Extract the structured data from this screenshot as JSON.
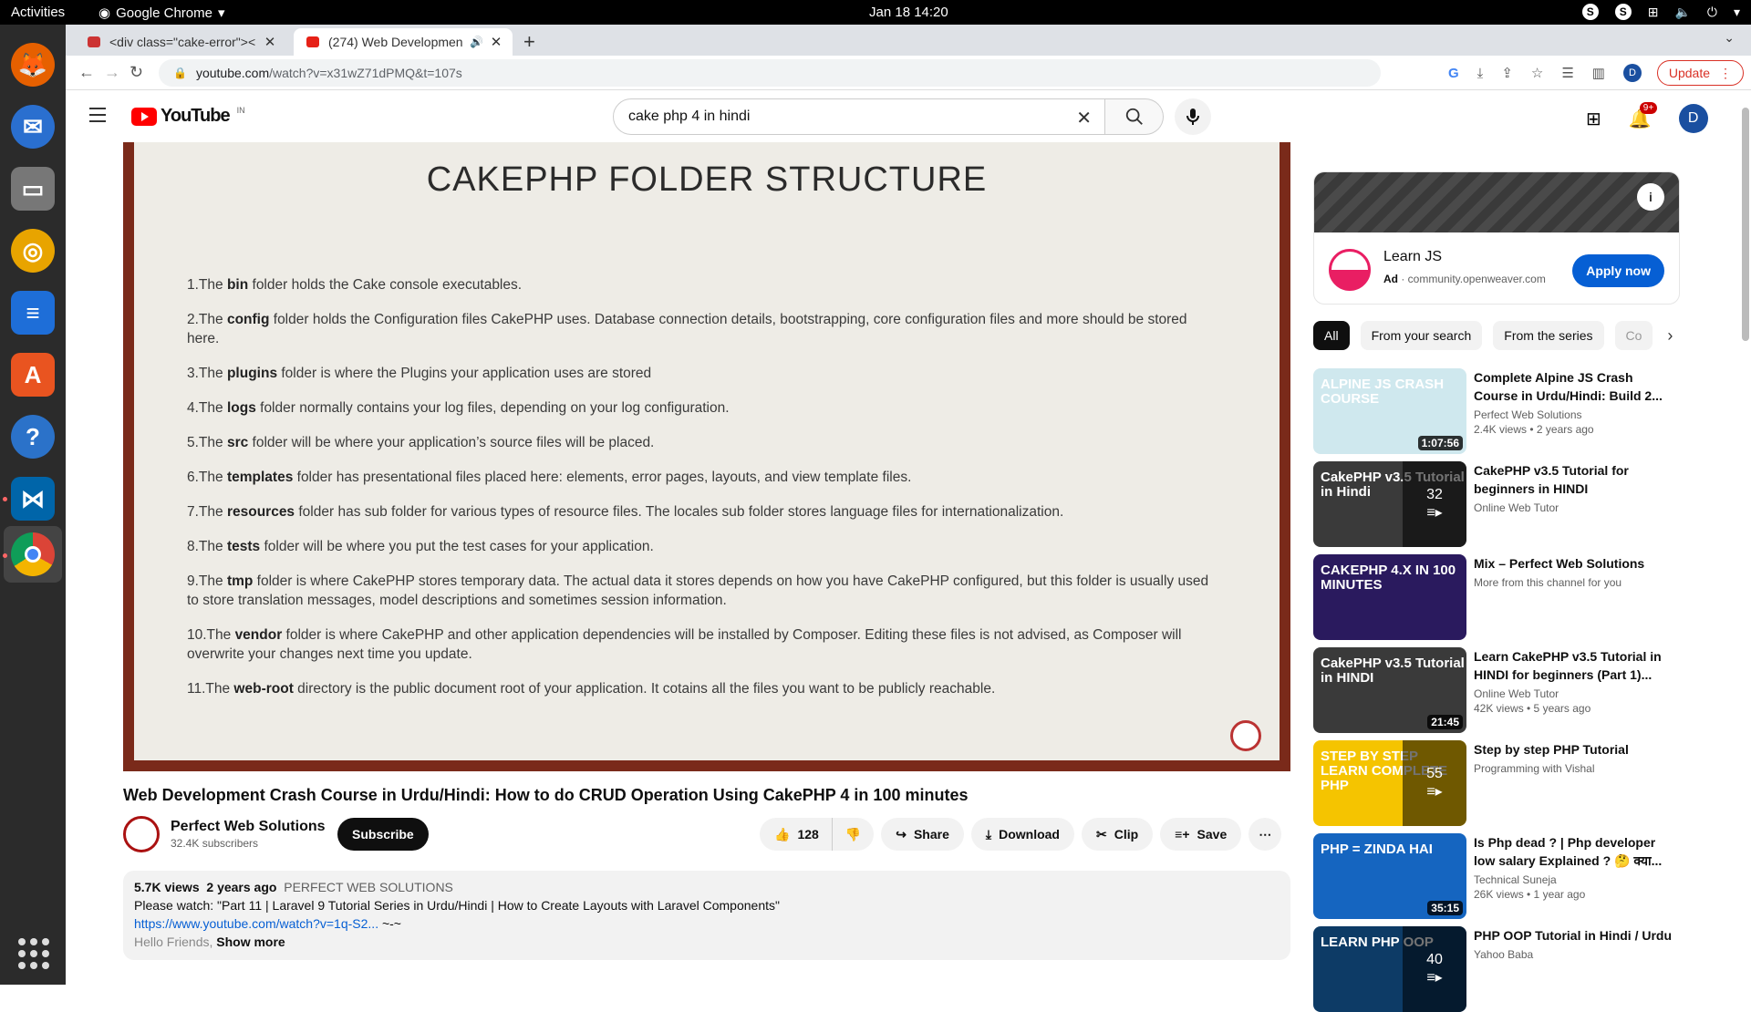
{
  "os": {
    "activities": "Activities",
    "app_name": "Google Chrome",
    "clock": "Jan 18  14:20"
  },
  "browser": {
    "tabs": [
      {
        "title": "<div class=\"cake-error\"><"
      },
      {
        "title": "(274) Web Developmen"
      }
    ],
    "url_host": "youtube.com",
    "url_path": "/watch?v=x31wZ71dPMQ&t=107s",
    "profile_letter": "D",
    "update_label": "Update"
  },
  "youtube": {
    "logo_text": "YouTube",
    "region": "IN",
    "search_query": "cake php 4 in hindi",
    "notif_count": "9+",
    "avatar_letter": "D"
  },
  "slide": {
    "heading": "CAKEPHP FOLDER STRUCTURE",
    "items": [
      {
        "n": "1.The ",
        "b": "bin",
        "t": " folder holds the Cake console executables."
      },
      {
        "n": "2.The ",
        "b": "config",
        "t": " folder holds the Configuration files CakePHP uses. Database connection details, bootstrapping, core configuration files and more should be stored here."
      },
      {
        "n": "3.The ",
        "b": "plugins",
        "t": " folder is where the Plugins your application uses are stored"
      },
      {
        "n": "4.The ",
        "b": "logs",
        "t": " folder normally contains your log files, depending on your log configuration."
      },
      {
        "n": "5.The ",
        "b": "src",
        "t": " folder will be where your application’s source files will be placed."
      },
      {
        "n": "6.The ",
        "b": "templates",
        "t": " folder has presentational files placed here: elements, error pages, layouts, and view template files."
      },
      {
        "n": "7.The ",
        "b": "resources",
        "t": " folder has sub folder for various types of resource files. The locales sub folder stores language files for internationalization."
      },
      {
        "n": "8.The ",
        "b": "tests",
        "t": " folder will be where you put the test cases for your application."
      },
      {
        "n": "9.The ",
        "b": "tmp",
        "t": " folder is where CakePHP stores temporary data. The actual data it stores depends on how you have CakePHP configured, but this folder is usually used to store translation messages, model descriptions and sometimes session information."
      },
      {
        "n": "10.The ",
        "b": "vendor",
        "t": " folder is where CakePHP and other application dependencies will be installed by Composer. Editing these files is not advised, as Composer will overwrite your changes next time you update."
      },
      {
        "n": "11.The ",
        "b": "web-root",
        "t": " directory is the public document root of your application. It cotains all the files you want to be publicly reachable."
      }
    ]
  },
  "video": {
    "title": "Web Development Crash Course in Urdu/Hindi: How to do CRUD Operation Using CakePHP 4 in 100 minutes",
    "channel": "Perfect Web Solutions",
    "subscribers": "32.4K subscribers",
    "subscribe_label": "Subscribe",
    "likes": "128",
    "share": "Share",
    "download": "Download",
    "clip": "Clip",
    "save": "Save",
    "views": "5.7K views",
    "age": "2 years ago",
    "tag": "PERFECT WEB SOLUTIONS",
    "desc_line1": "Please watch: \"Part 11 | Laravel 9 Tutorial Series in Urdu/Hindi | How to Create Layouts with Laravel Components\"",
    "desc_link": "https://www.youtube.com/watch?v=1q-S2...",
    "desc_link_tail": " ~-~",
    "desc_line3": "Hello Friends,",
    "show_more": "Show more"
  },
  "ad": {
    "title": "Learn JS",
    "ad_label": "Ad",
    "domain": "community.openweaver.com",
    "cta": "Apply now"
  },
  "chips": [
    "All",
    "From your search",
    "From the series",
    "Co"
  ],
  "recommendations": [
    {
      "title": "Complete Alpine JS Crash Course in Urdu/Hindi: Build 2...",
      "channel": "Perfect Web Solutions",
      "meta": "2.4K views • 2 years ago",
      "duration": "1:07:56",
      "thumb_text": "ALPINE JS CRASH COURSE",
      "color": "#cfe8ee"
    },
    {
      "title": "CakePHP v3.5 Tutorial for beginners in HINDI",
      "channel": "Online Web Tutor",
      "meta": "",
      "playlist": "32",
      "thumb_text": "CakePHP v3.5 Tutorial in Hindi",
      "color": "#3a3a3a"
    },
    {
      "title": "Mix – Perfect Web Solutions",
      "channel": "More from this channel for you",
      "meta": "",
      "thumb_text": "CAKEPHP 4.X IN 100 MINUTES",
      "color": "#2a1a5e"
    },
    {
      "title": "Learn CakePHP v3.5 Tutorial in HINDI for beginners (Part 1)...",
      "channel": "Online Web Tutor",
      "meta": "42K views • 5 years ago",
      "duration": "21:45",
      "thumb_text": "CakePHP v3.5 Tutorial in HINDI",
      "color": "#3a3a3a"
    },
    {
      "title": "Step by step PHP Tutorial",
      "channel": "Programming with Vishal",
      "meta": "",
      "playlist": "55",
      "thumb_text": "STEP BY STEP LEARN COMPLETE PHP",
      "color": "#f5c400"
    },
    {
      "title": "Is Php dead ? | Php developer low salary Explained ? 🤔 क्या...",
      "channel": "Technical Suneja",
      "meta": "26K views • 1 year ago",
      "duration": "35:15",
      "thumb_text": "PHP = ZINDA HAI",
      "color": "#1565c0"
    },
    {
      "title": "PHP OOP Tutorial in Hindi / Urdu",
      "channel": "Yahoo Baba",
      "meta": "",
      "playlist": "40",
      "thumb_text": "LEARN PHP OOP",
      "color": "#0d3b66"
    }
  ]
}
